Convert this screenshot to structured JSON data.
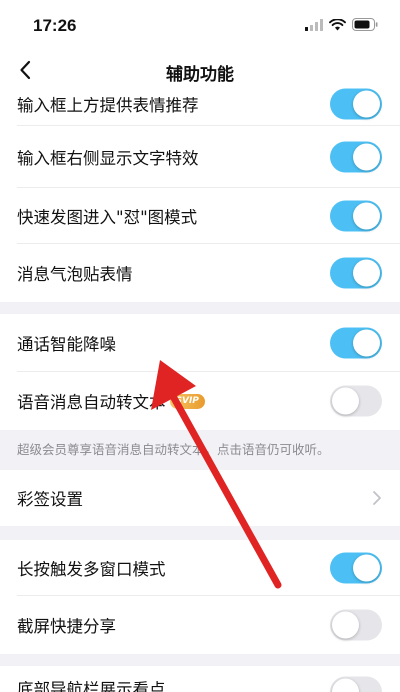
{
  "status_bar": {
    "time": "17:26"
  },
  "nav": {
    "title": "辅助功能"
  },
  "rows": [
    {
      "label": "输入框上方提供表情推荐",
      "toggle": "on"
    },
    {
      "label": "输入框右侧显示文字特效",
      "toggle": "on"
    },
    {
      "label": "快速发图进入\"怼\"图模式",
      "toggle": "on"
    },
    {
      "label": "消息气泡贴表情",
      "toggle": "on"
    },
    {
      "label": "通话智能降噪",
      "toggle": "on"
    },
    {
      "label": "语音消息自动转文本",
      "badge": "SVIP",
      "toggle": "off"
    },
    {
      "label": "彩签设置"
    },
    {
      "label": "长按触发多窗口模式",
      "toggle": "on"
    },
    {
      "label": "截屏快捷分享",
      "toggle": "off"
    },
    {
      "label": "底部导航栏展示看点",
      "toggle": "off"
    }
  ],
  "hint": {
    "text": "超级会员尊享语音消息自动转文本，点击语音仍可收听。"
  },
  "colors": {
    "toggle_on": "#4cc0f4",
    "toggle_off": "#e6e6ea",
    "annotation_arrow": "#e02424",
    "svip_badge": "#f0b040"
  }
}
